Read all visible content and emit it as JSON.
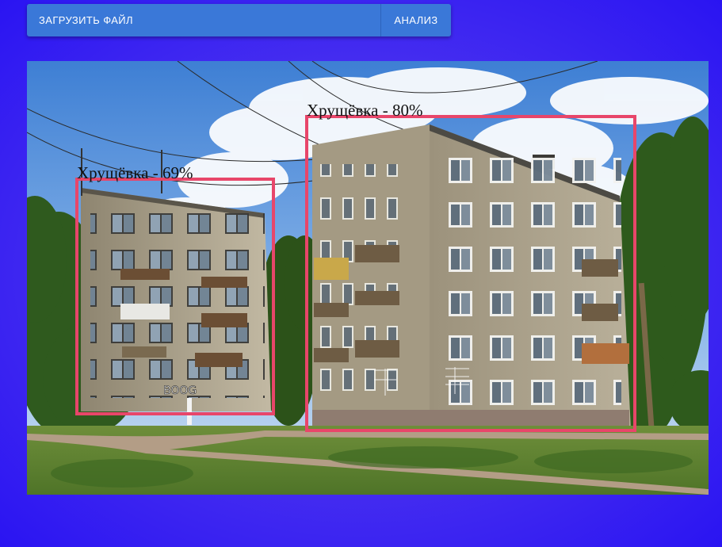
{
  "toolbar": {
    "upload_label": "ЗАГРУЗИТЬ ФАЙЛ",
    "analyze_label": "АНАЛИЗ"
  },
  "detections": [
    {
      "label": "Хрущёвка - 69%"
    },
    {
      "label": "Хрущёвка - 80%"
    }
  ],
  "colors": {
    "toolbar": "#3a78d8",
    "box": "#e8466a"
  }
}
